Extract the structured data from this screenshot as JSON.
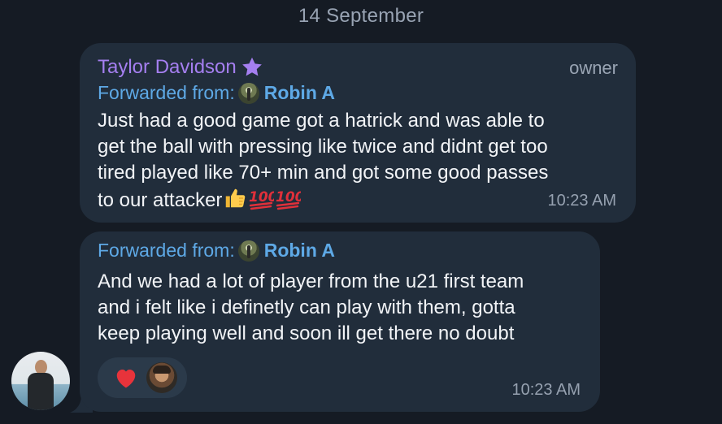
{
  "date_separator": "14 September",
  "messages": [
    {
      "sender": "Taylor Davidson",
      "sender_badge_icon": "star-icon",
      "role": "owner",
      "forwarded_label": "Forwarded from:",
      "forwarded_name": "Robin A",
      "text": "Just had a good game got a hatrick and was able to\nget the ball with pressing like twice and didnt get too\ntired played like 70+ min and got some good passes\nto our attacker",
      "trailing_emojis": [
        "thumbs-up-icon",
        "hundred-points-icon",
        "hundred-points-icon"
      ],
      "time": "10:23 AM"
    },
    {
      "forwarded_label": "Forwarded from:",
      "forwarded_name": "Robin A",
      "text": "And we had a lot of player from the u21 first team\nand i felt like i definetly can play with them, gotta\nkeep playing well and soon ill get there no doubt",
      "reaction": "heart-icon",
      "time": "10:23 AM"
    }
  ],
  "colors": {
    "background": "#151b24",
    "bubble": "#212d3b",
    "sender_name": "#a57ff0",
    "link": "#5ea9e6",
    "reaction_heart": "#e8333b"
  }
}
